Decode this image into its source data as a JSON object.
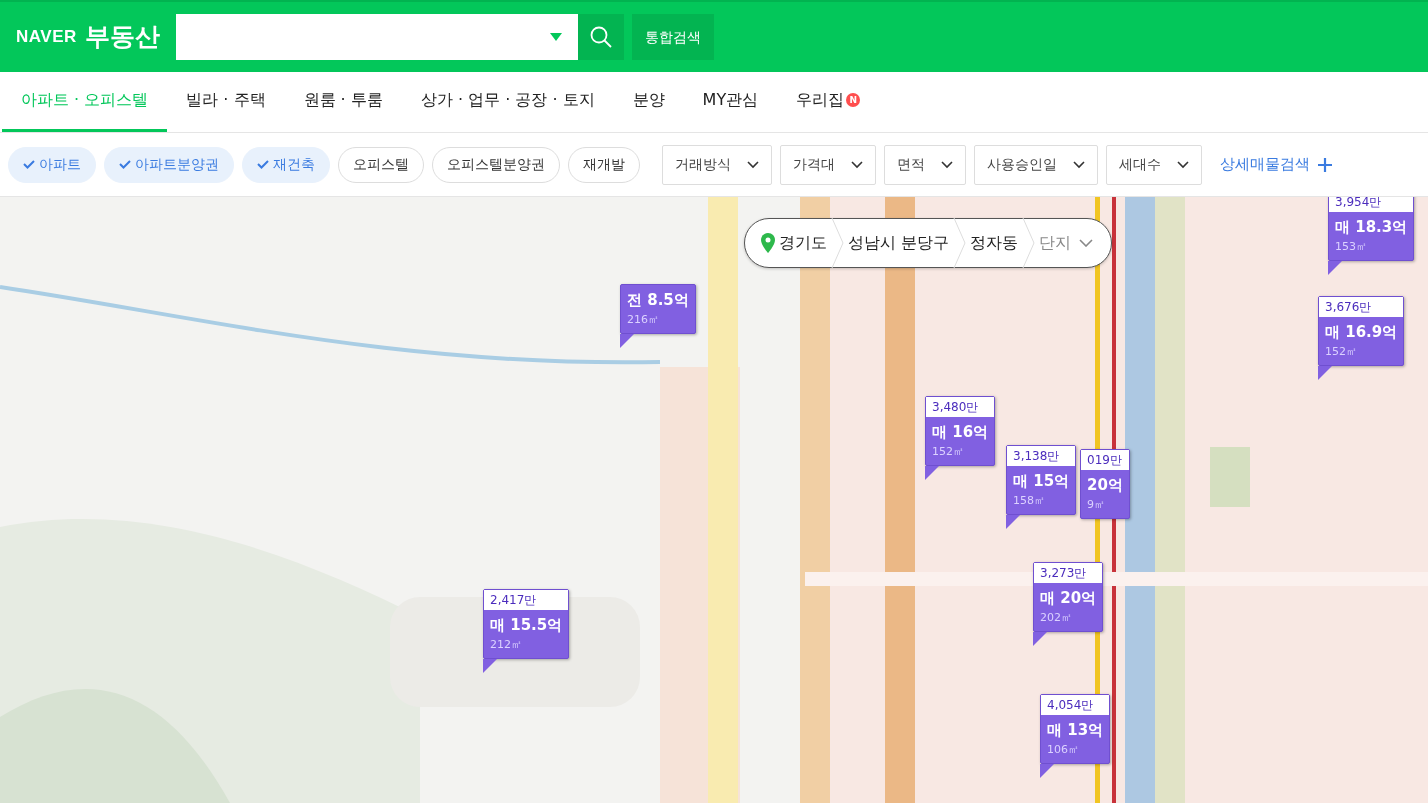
{
  "header": {
    "logo": "NAVER",
    "service": "부동산",
    "search_button": "통합검색"
  },
  "nav_tabs": [
    {
      "label": "아파트 · 오피스텔",
      "selected": true
    },
    {
      "label": "빌라 · 주택",
      "selected": false
    },
    {
      "label": "원룸 · 투룸",
      "selected": false
    },
    {
      "label": "상가 · 업무 · 공장 · 토지",
      "selected": false
    },
    {
      "label": "분양",
      "selected": false
    },
    {
      "label": "MY관심",
      "selected": false
    },
    {
      "label": "우리집",
      "selected": false,
      "new_badge": "N"
    }
  ],
  "type_chips": [
    {
      "label": "아파트",
      "selected": true
    },
    {
      "label": "아파트분양권",
      "selected": true
    },
    {
      "label": "재건축",
      "selected": true
    },
    {
      "label": "오피스텔",
      "selected": false
    },
    {
      "label": "오피스텔분양권",
      "selected": false
    },
    {
      "label": "재개발",
      "selected": false
    }
  ],
  "filters": [
    "거래방식",
    "가격대",
    "면적",
    "사용승인일",
    "세대수"
  ],
  "detail_search": "상세매물검색",
  "breadcrumb": [
    {
      "label": "경기도",
      "kind": "region"
    },
    {
      "label": "성남시 분당구",
      "kind": "region"
    },
    {
      "label": "정자동",
      "kind": "region"
    },
    {
      "label": "단지",
      "kind": "placeholder"
    }
  ],
  "markers": [
    {
      "unit_price": "3,954만",
      "price_type": "매",
      "price": "18.3억",
      "area": "153㎡"
    },
    {
      "price_type": "전",
      "price": "8.5억",
      "area": "216㎡"
    },
    {
      "unit_price": "3,676만",
      "price_type": "매",
      "price": "16.9억",
      "area": "152㎡"
    },
    {
      "unit_price": "3,480만",
      "price_type": "매",
      "price": "16억",
      "area": "152㎡"
    },
    {
      "unit_price": "3,138만",
      "price_type": "매",
      "price": "15억",
      "area": "158㎡"
    },
    {
      "unit_price": "019만",
      "price": "20억",
      "area": "9㎡"
    },
    {
      "unit_price": "2,417만",
      "price_type": "매",
      "price": "15.5억",
      "area": "212㎡"
    },
    {
      "unit_price": "3,273만",
      "price_type": "매",
      "price": "20억",
      "area": "202㎡"
    },
    {
      "unit_price": "4,054만",
      "price_type": "매",
      "price": "13억",
      "area": "106㎡"
    }
  ]
}
